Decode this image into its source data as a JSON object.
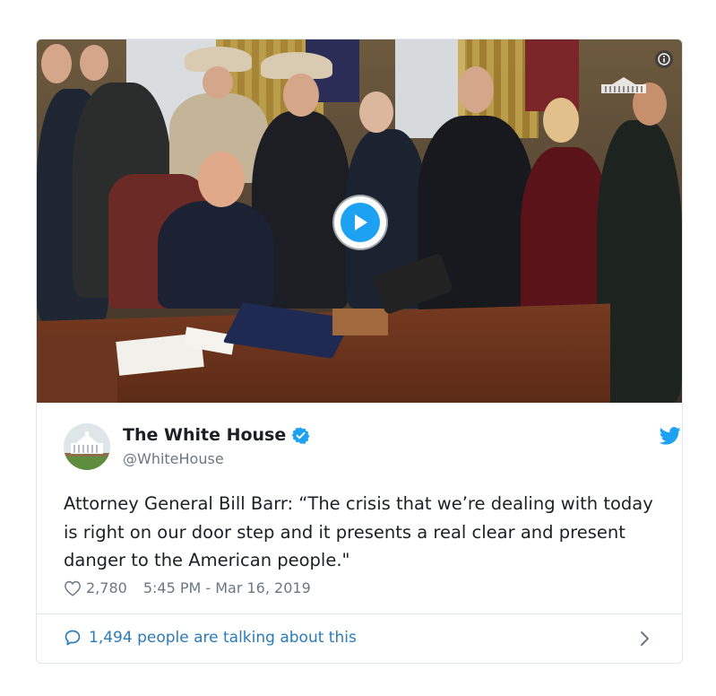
{
  "tweet": {
    "author": {
      "display_name": "The White House",
      "handle": "@WhiteHouse",
      "verified": true,
      "avatar_icon": "white-house-avatar"
    },
    "text": "Attorney General Bill Barr: “The crisis that we’re dealing with today is right on our door step and it presents a real clear and present danger to the American people.\"",
    "likes": "2,780",
    "timestamp": "5:45 PM - Mar 16, 2019",
    "talking_label": "1,494 people are talking about this"
  },
  "media": {
    "type": "video",
    "play_icon": "play-icon",
    "info_icon": "info-icon"
  },
  "icons": {
    "brand": "twitter-bird-icon",
    "verified": "verified-badge-icon",
    "like": "heart-icon",
    "reply": "speech-bubble-icon",
    "chevron": "chevron-right-icon"
  },
  "colors": {
    "accent": "#1da1f2",
    "link": "#2b7bb9",
    "muted": "#697882",
    "text": "#1c2022",
    "border": "#e1e8ed"
  }
}
